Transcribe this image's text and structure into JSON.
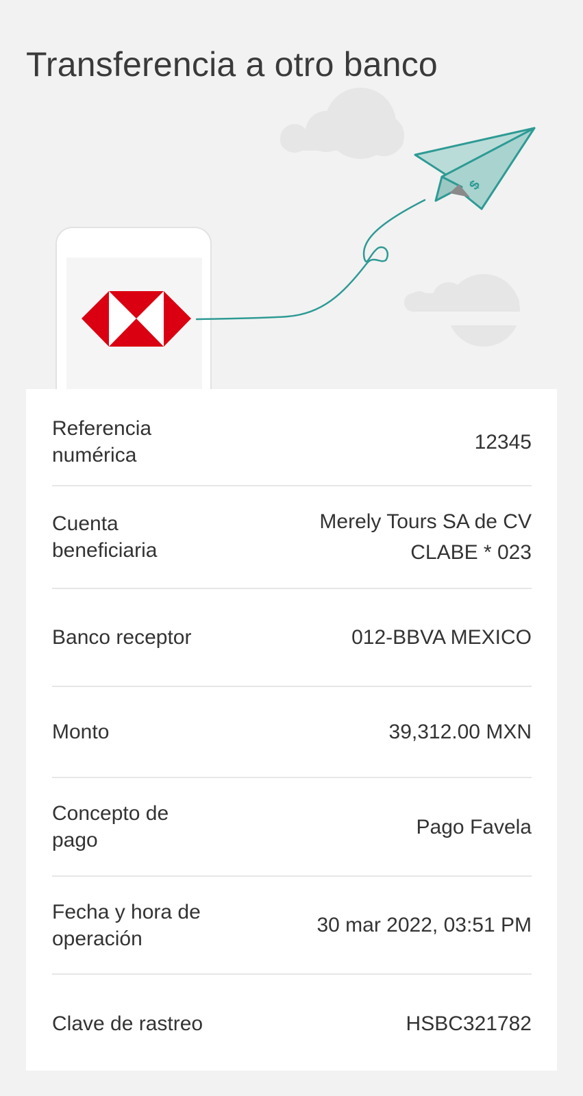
{
  "page": {
    "title": "Transferencia a otro banco"
  },
  "colors": {
    "background": "#f2f2f2",
    "card": "#ffffff",
    "divider": "#e6e6e6",
    "hsbc_red": "#db0011",
    "plane_teal": "#a9d3cf",
    "plane_stroke": "#2e9a94",
    "cloud": "#e6e6e6"
  },
  "illustration": {
    "icons": [
      "phone-icon",
      "hsbc-logo",
      "paper-plane-icon",
      "cloud-icon"
    ]
  },
  "details": {
    "reference": {
      "label": "Referencia numérica",
      "value": "12345"
    },
    "beneficiary": {
      "label": "Cuenta beneficiaria",
      "value_line1": "Merely Tours SA de CV",
      "value_line2": "CLABE * 023"
    },
    "bank": {
      "label": "Banco receptor",
      "value": "012-BBVA MEXICO"
    },
    "amount": {
      "label": "Monto",
      "value": "39,312.00 MXN"
    },
    "concept": {
      "label": "Concepto de pago",
      "value": "Pago Favela"
    },
    "datetime": {
      "label": "Fecha y hora de operación",
      "value": "30 mar 2022, 03:51 PM"
    },
    "tracking": {
      "label": "Clave de rastreo",
      "value": "HSBC321782"
    }
  }
}
